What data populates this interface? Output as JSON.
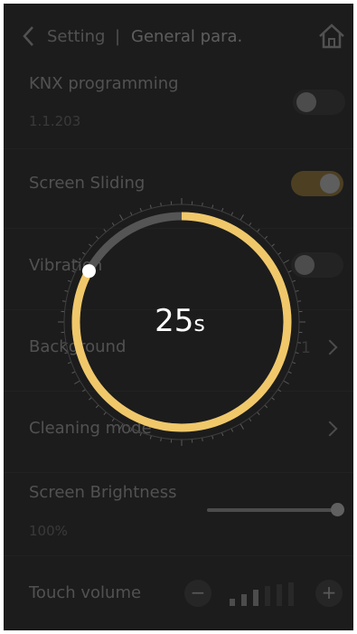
{
  "header": {
    "back_label": "Setting",
    "separator": "|",
    "title": "General para."
  },
  "rows": {
    "knx": {
      "title": "KNX programming",
      "address": "1.1.203",
      "toggle_on": false
    },
    "screen_sliding": {
      "title": "Screen Sliding",
      "toggle_on": true
    },
    "vibration": {
      "title": "Vibration",
      "toggle_on": false
    },
    "background": {
      "title": "Background",
      "value": "1"
    },
    "cleaning": {
      "title": "Cleaning mode"
    },
    "brightness": {
      "title": "Screen Brightness",
      "value": "100%",
      "level": 1.0
    },
    "volume": {
      "title": "Touch volume",
      "minus": "−",
      "plus": "+",
      "level_bars_filled": 3,
      "level_bars_total": 6
    }
  },
  "dial": {
    "value": "25",
    "unit": "s",
    "progress_fraction": 0.83,
    "colors": {
      "accent": "#f0c86a",
      "track": "#555555"
    }
  }
}
